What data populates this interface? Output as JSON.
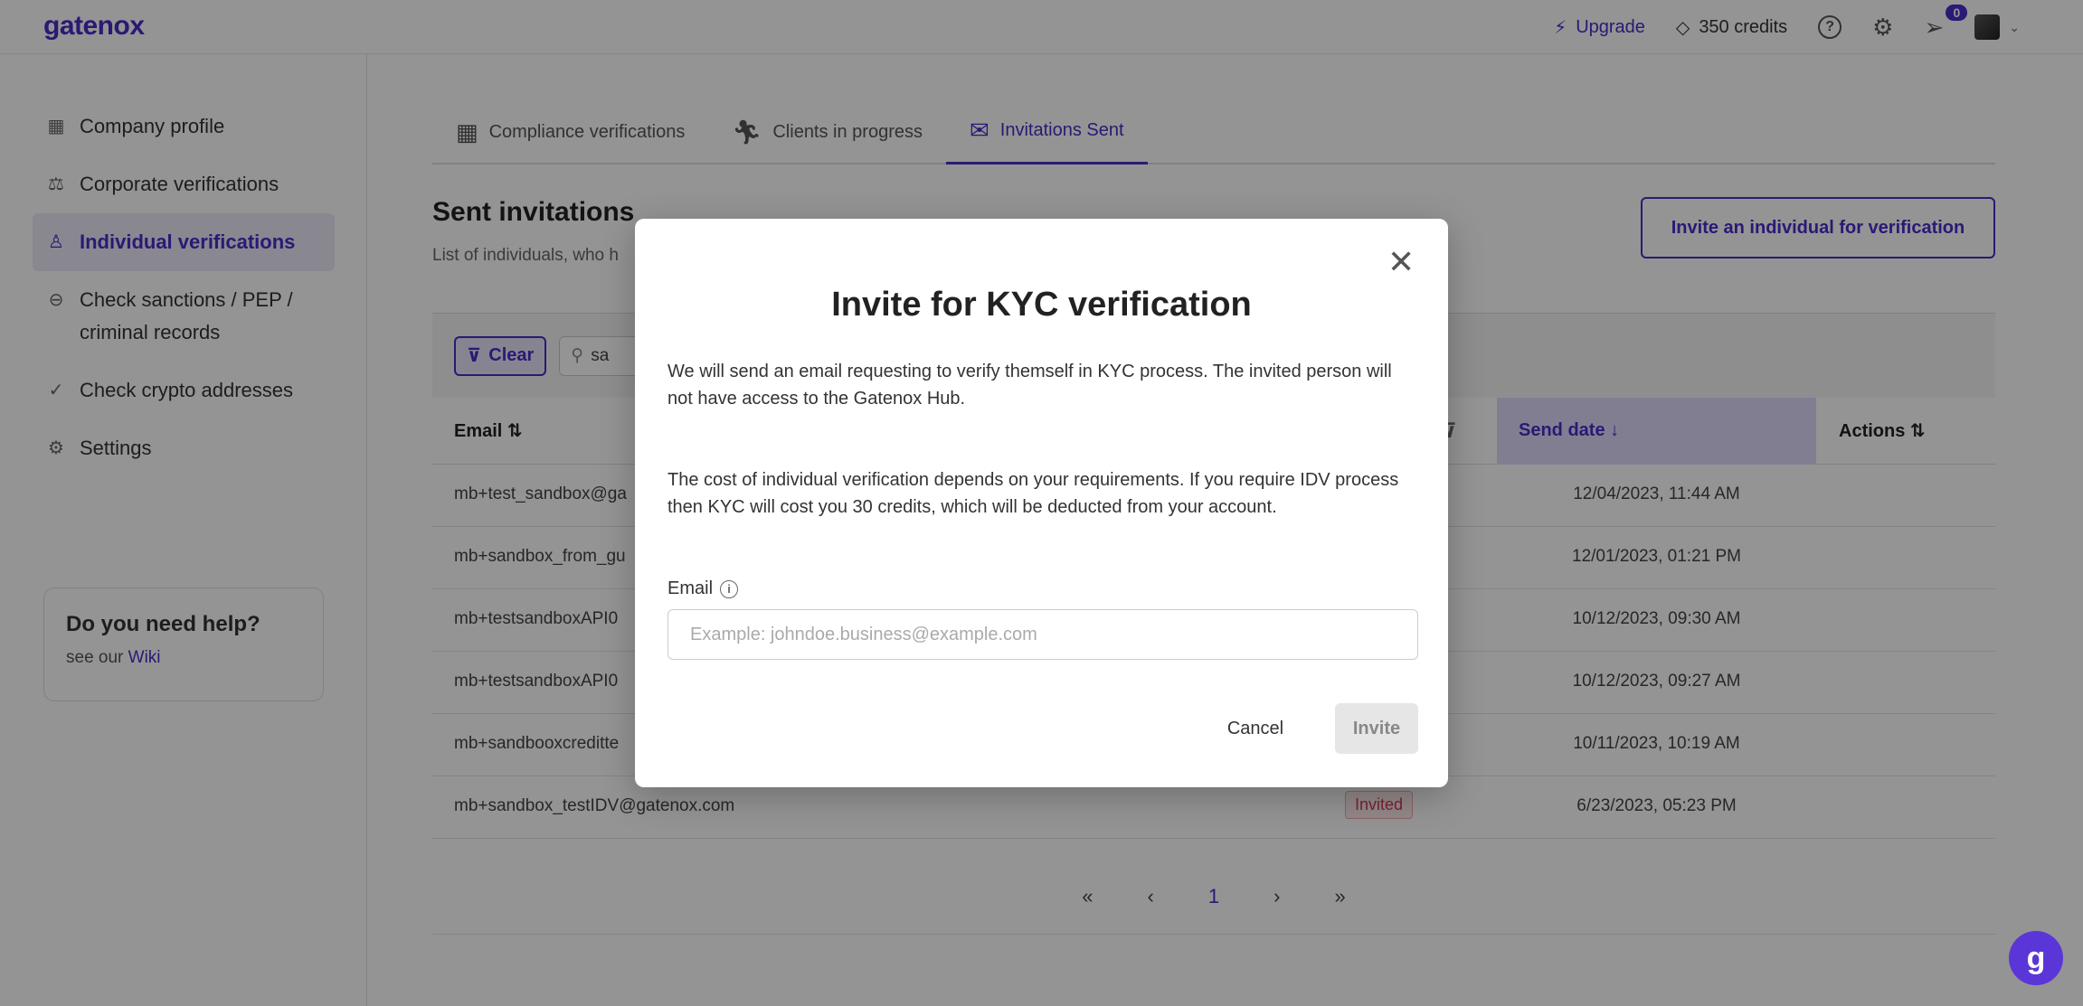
{
  "header": {
    "logo": "gatenox",
    "upgrade_label": "Upgrade",
    "credits_label": "350 credits",
    "notifications_count": "0"
  },
  "sidebar": {
    "items": [
      {
        "label": "Company profile",
        "icon": "building-icon"
      },
      {
        "label": "Corporate verifications",
        "icon": "scales-icon"
      },
      {
        "label": "Individual verifications",
        "icon": "person-icon",
        "active": true
      },
      {
        "label": "Check sanctions / PEP / criminal records",
        "icon": "minus-circle-icon"
      },
      {
        "label": "Check crypto addresses",
        "icon": "check-icon"
      },
      {
        "label": "Settings",
        "icon": "gear-icon"
      }
    ],
    "help": {
      "title": "Do you need help?",
      "text": "see our",
      "link": "Wiki"
    }
  },
  "main": {
    "tabs": [
      {
        "label": "Compliance verifications"
      },
      {
        "label": "Clients in progress"
      },
      {
        "label": "Invitations Sent",
        "active": true
      }
    ],
    "title": "Sent invitations",
    "subtitle": "List of individuals, who h",
    "invite_button": "Invite an individual for verification",
    "filters": {
      "clear_label": "Clear",
      "search_value": "sa"
    },
    "table": {
      "columns": {
        "email": "Email ⇅",
        "send_date": "Send date ↓",
        "actions": "Actions ⇅"
      },
      "rows": [
        {
          "email": "mb+test_sandbox@ga",
          "status": "",
          "send_date": "12/04/2023, 11:44 AM"
        },
        {
          "email": "mb+sandbox_from_gu",
          "status": "",
          "send_date": "12/01/2023, 01:21 PM"
        },
        {
          "email": "mb+testsandboxAPI0",
          "status": "",
          "send_date": "10/12/2023, 09:30 AM"
        },
        {
          "email": "mb+testsandboxAPI0",
          "status": "",
          "send_date": "10/12/2023, 09:27 AM"
        },
        {
          "email": "mb+sandbooxcreditte",
          "status": "",
          "send_date": "10/11/2023, 10:19 AM"
        },
        {
          "email": "mb+sandbox_testIDV@gatenox.com",
          "status": "Invited",
          "send_date": "6/23/2023, 05:23 PM"
        }
      ]
    },
    "pagination": {
      "first": "«",
      "prev": "‹",
      "current": "1",
      "next": "›",
      "last": "»"
    }
  },
  "modal": {
    "title": "Invite for KYC verification",
    "paragraph1": "We will send an email requesting to verify themself in KYC process. The invited person will not have access to the Gatenox Hub.",
    "paragraph2": "The cost of individual verification depends on your requirements. If you require IDV process then KYC will cost you 30 credits, which will be deducted from your account.",
    "email_label": "Email",
    "email_value": "",
    "email_placeholder": "Example: johndoe.business@example.com",
    "cancel_label": "Cancel",
    "invite_label": "Invite"
  },
  "colors": {
    "accent": "#4a2bc8",
    "invited_badge": "#d23a55"
  }
}
